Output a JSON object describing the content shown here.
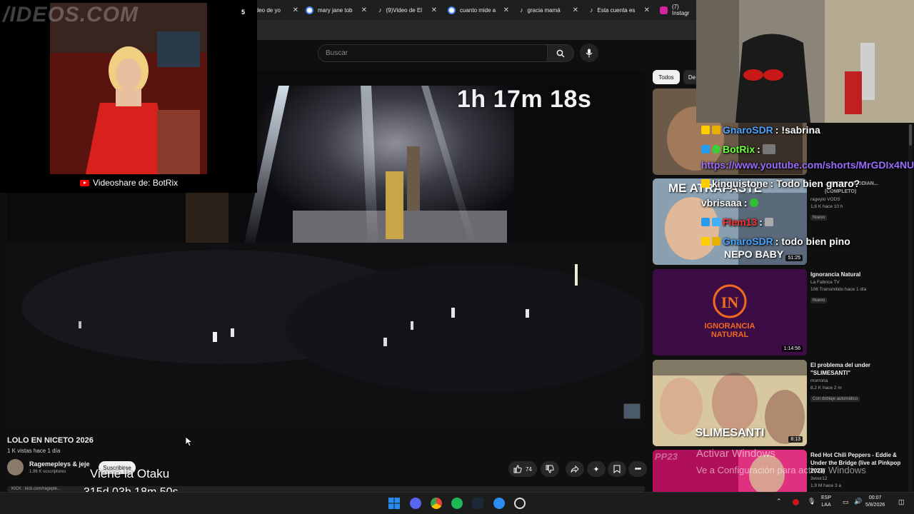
{
  "browser": {
    "tabs": [
      {
        "label": "ideo de yo",
        "icon_color": "#ff0000"
      },
      {
        "label": "mary jane tob",
        "icon_color": "#4285f4"
      },
      {
        "label": "(9)Video de El",
        "icon_color": "#ffffff"
      },
      {
        "label": "cuanto mide a",
        "icon_color": "#4285f4"
      },
      {
        "label": "gracia mamá",
        "icon_color": "#ffffff"
      },
      {
        "label": "Esta cuenta es",
        "icon_color": "#ffffff"
      },
      {
        "label": "(7) Instagr",
        "icon_color": "#d6249f"
      }
    ],
    "tab_badge": "5"
  },
  "youtube": {
    "search_placeholder": "Buscar",
    "chips": [
      "Todos",
      "De"
    ]
  },
  "stream_overlay": {
    "watermark": "/IDEOS.COM",
    "videoshare_caption": "Videoshare de: BotRix",
    "timer": "1h 17m 18s",
    "viene": "Viene la Otaku",
    "countdown": "315d 03h 18m 50s",
    "activate_windows_1": "Activar Windows",
    "activate_windows_2": "Ve a Configuración para activar Windows",
    "pp23": "PP23"
  },
  "video": {
    "title": "LOLO EN NICETO 2026",
    "meta": "1 K vistas  hace 1 día",
    "channel_name": "Ragemepleys & jeje",
    "channel_subs": "1.96 K suscriptores",
    "subscribe_label": "Suscribirse",
    "description_snippet": "KICK : kick.com/rageple...",
    "likes": "74"
  },
  "chat": [
    {
      "user": "GnaroSDR",
      "message": ": !sabrina",
      "user_color": "#4aa3ff"
    },
    {
      "user": "BotRix",
      "message": ":",
      "user_color": "#6aff3a"
    },
    {
      "user": "",
      "message": "https://www.youtube.com/shorts/MrGDIx4NU",
      "user_color": "#9a6bff"
    },
    {
      "user": "kinguistone",
      "message": ": Todo bien gnaro?",
      "user_color": "#ffffff"
    },
    {
      "user": "vbrisaaa",
      "message": ":",
      "user_color": "#ffffff"
    },
    {
      "user": "Flem13",
      "message": ":",
      "user_color": "#ff3030"
    },
    {
      "user": "GnaroSDR",
      "message": ": todo bien pino",
      "user_color": "#4aa3ff"
    }
  ],
  "sidebar": {
    "cards": [
      {
        "title": "",
        "channel": "",
        "stats": "",
        "badge": "",
        "duration": ""
      },
      {
        "title": "...MADOS ME ODIAN... (COMPLETO)",
        "channel": "rageylo VODS",
        "stats": "1,6 K  hace 10 h",
        "badge": "Nuevo",
        "duration": "51:25",
        "thumb_text_1": "ME ATRAPASTE",
        "thumb_text_2": "NEPO BABY"
      },
      {
        "title": "Ignorancia Natural",
        "channel": "La Fabrica TV",
        "stats": "106  Transmitido hace 1 día",
        "badge": "Nuevo",
        "duration": "1:14:56",
        "thumb_text_1": "IGNORANCIA",
        "thumb_text_2": "NATURAL"
      },
      {
        "title": "El problema del under \"SLIMESANTI\"",
        "channel": "morrona",
        "stats": "8,2 K  hace 2 m",
        "badge": "Con doblaje automático",
        "duration": "8:13",
        "thumb_text_1": "SLIMESANTI"
      },
      {
        "title": "Red Hot Chili Peppers - Eddie & Under the Bridge (live at Pinkpop 2023)",
        "channel": "3voor12",
        "stats": "1,9 M  hace 3 a",
        "badge": "",
        "duration": ""
      }
    ]
  },
  "taskbar": {
    "lang_top": "ESP",
    "lang_bottom": "LAA",
    "time": "00:07",
    "date": "5/8/2026"
  }
}
